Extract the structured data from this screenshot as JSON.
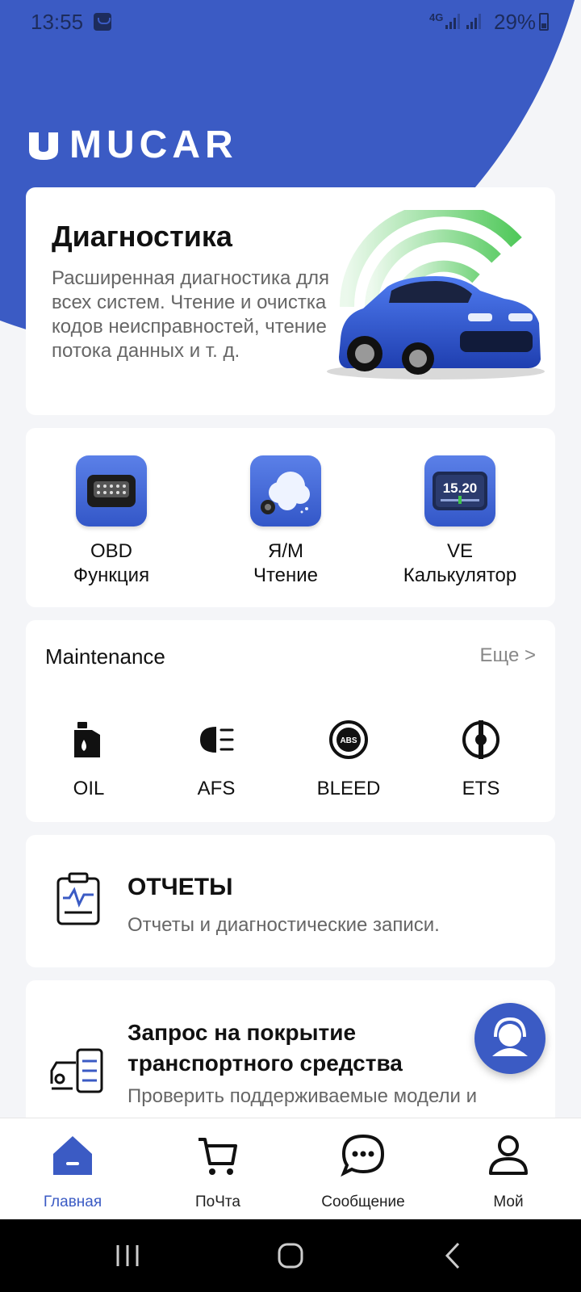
{
  "status_bar": {
    "time": "13:55",
    "network": "4G",
    "battery": "29%"
  },
  "brand": {
    "name": "MUCAR",
    "color": "#3b5bc4"
  },
  "diagnostics": {
    "title": "Диагностика",
    "description": "Расширенная диагностика для всех систем. Чтение и очистка кодов неисправностей, чтение потока данных и т. д."
  },
  "quick_functions": [
    {
      "line1": "OBD",
      "line2": "Функция",
      "icon": "obd-connector-icon"
    },
    {
      "line1": "Я/М",
      "line2": "Чтение",
      "icon": "smoke-icon"
    },
    {
      "line1": "VE",
      "line2": "Калькулятор",
      "icon": "gauge-icon",
      "display": "15.20"
    }
  ],
  "maintenance": {
    "title": "Maintenance",
    "more": "Еще >",
    "items": [
      {
        "label": "OIL",
        "icon": "oil-can-icon"
      },
      {
        "label": "AFS",
        "icon": "headlight-icon"
      },
      {
        "label": "BLEED",
        "icon": "abs-icon",
        "badge": "ABS"
      },
      {
        "label": "ETS",
        "icon": "throttle-icon"
      }
    ]
  },
  "reports": {
    "title": "ОТЧЕТЫ",
    "description": "Отчеты и диагностические записи."
  },
  "coverage": {
    "title": "Запрос на покрытие транспортного средства",
    "description": "Проверить поддерживаемые модели и"
  },
  "bottom_nav": [
    {
      "label": "Главная",
      "icon": "home-icon",
      "active": true
    },
    {
      "label": "ПоЧта",
      "icon": "cart-icon",
      "active": false
    },
    {
      "label": "Сообщение",
      "icon": "chat-icon",
      "active": false
    },
    {
      "label": "Мой",
      "icon": "profile-icon",
      "active": false
    }
  ]
}
